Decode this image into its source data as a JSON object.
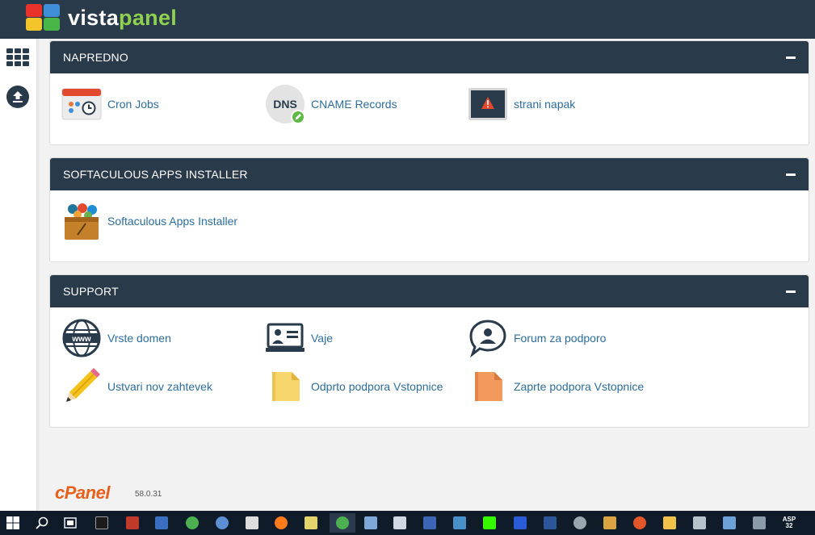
{
  "header": {
    "brand_main": "vista",
    "brand_accent": "panel"
  },
  "sidebar": {
    "items": [
      {
        "icon": "apps-grid-icon"
      },
      {
        "icon": "upload-icon"
      }
    ]
  },
  "sections": [
    {
      "title": "NAPREDNO",
      "items": [
        {
          "label": "Cron Jobs",
          "icon": "cron-jobs-icon"
        },
        {
          "label": "CNAME Records",
          "icon": "dns-icon",
          "icon_text": "DNS"
        },
        {
          "label": "strani napak",
          "icon": "error-page-icon"
        }
      ]
    },
    {
      "title": "SOFTACULOUS APPS INSTALLER",
      "items": [
        {
          "label": "Softaculous Apps Installer",
          "icon": "softaculous-icon"
        }
      ]
    },
    {
      "title": "SUPPORT",
      "items": [
        {
          "label": "Vrste domen",
          "icon": "www-globe-icon",
          "icon_text": "www"
        },
        {
          "label": "Vaje",
          "icon": "video-tutorial-icon"
        },
        {
          "label": "Forum za podporo",
          "icon": "forum-chat-icon"
        },
        {
          "label": "Ustvari nov zahtevek",
          "icon": "pencil-icon"
        },
        {
          "label": "Odprto podpora Vstopnice",
          "icon": "open-folder-icon"
        },
        {
          "label": "Zaprte podpora Vstopnice",
          "icon": "closed-folder-icon"
        }
      ]
    }
  ],
  "footer": {
    "logo": "cPanel",
    "version": "58.0.31"
  },
  "taskbar": {
    "asp_badge_top": "ASP",
    "asp_badge_bottom": "32"
  },
  "colors": {
    "header_bg": "#293a4a",
    "link": "#2d6e9e",
    "page_bg": "#f2f2f2",
    "cpanel_orange": "#e8601c"
  }
}
